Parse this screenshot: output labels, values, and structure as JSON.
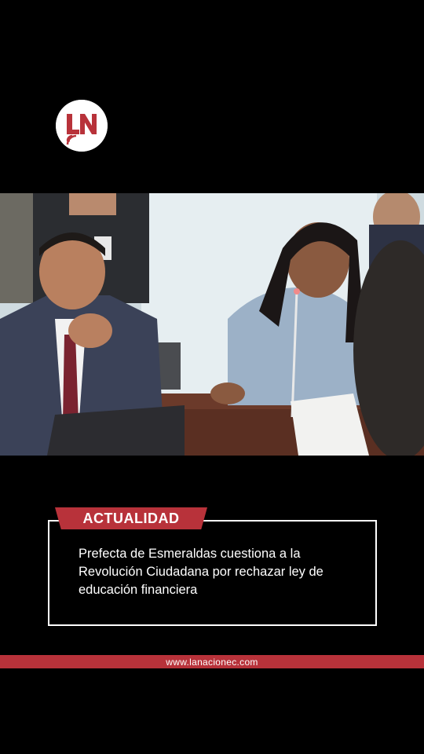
{
  "brand": {
    "logo_text": "LN",
    "accent_color": "#b8323a"
  },
  "video": {
    "description_icon": "video-frame-image"
  },
  "news": {
    "category": "ACTUALIDAD",
    "headline": "Prefecta de Esmeraldas cuestiona a la Revolución Ciudadana por rechazar ley de educación financiera"
  },
  "footer": {
    "url": "www.lanacionec.com"
  }
}
